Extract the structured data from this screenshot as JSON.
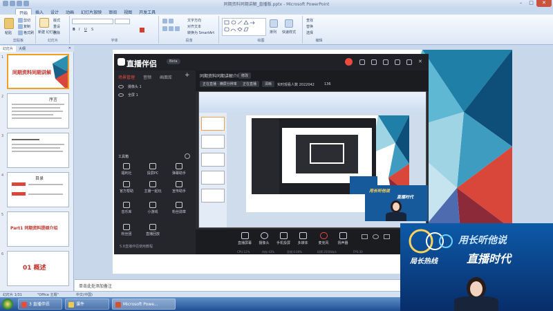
{
  "window": {
    "title": "同期资料同期讲解_直播版.pptx - Microsoft PowerPoint"
  },
  "ribbon": {
    "tabs": [
      "开始",
      "插入",
      "设计",
      "动画",
      "幻灯片放映",
      "审阅",
      "视图",
      "开发工具"
    ],
    "active_tab": "开始",
    "groups": [
      "剪贴板",
      "幻灯片",
      "字体",
      "段落",
      "绘图",
      "编辑"
    ],
    "paste_label": "粘贴",
    "new_slide_label": "新建\n幻灯片",
    "layout_label": "版式",
    "reset_label": "重设",
    "delete_label": "删除",
    "cut_label": "剪切",
    "copy_label": "复制",
    "format_painter_label": "格式刷",
    "text_direction_label": "文字方向",
    "align_text_label": "对齐文本",
    "smartart_label": "转换为 SmartArt",
    "arrange_label": "排列",
    "quick_styles_label": "快速样式",
    "find_label": "查找",
    "replace_label": "替换",
    "select_label": "选择"
  },
  "left_panel": {
    "tabs": [
      "幻灯片",
      "大纲"
    ],
    "slides": [
      {
        "num": "1",
        "title": "同期资料同期讲解"
      },
      {
        "num": "2",
        "title": "序言"
      },
      {
        "num": "3",
        "title": ""
      },
      {
        "num": "4",
        "title": "目录"
      },
      {
        "num": "5",
        "title": "Part1 同期资料提纲介绍"
      },
      {
        "num": "6",
        "title": "01 概述"
      },
      {
        "num": "7",
        "title": ""
      }
    ]
  },
  "live_app": {
    "logo": "直播伴侣",
    "beta": "Beta",
    "side_tabs": [
      "场景管理",
      "音频",
      "画面库"
    ],
    "scenes": [
      "摄像头 1",
      "全屏 1"
    ],
    "tools_title": "工具箱",
    "tools": [
      "福利社",
      "投屏PC",
      "弹幕助手",
      "官方帮助",
      "主播一起玩",
      "宣传助手",
      "音乐库",
      "小游戏",
      "粉丝勋章",
      "粉丝团",
      "直播回放"
    ],
    "footer": "5.8直播伴侣使用教程",
    "top": {
      "room_title": "同期资料同期讲解介绍",
      "edit": "修改",
      "chip1": "正在直播 · 横屏分辨率",
      "chip2": "正在直播",
      "chip3": "清晰",
      "stats": "实时观看人数 2022042",
      "likes": "136"
    },
    "bottom_buttons": [
      "直播屏幕",
      "摄像头",
      "手机投屏",
      "多媒体",
      "麦克风",
      "扬声器"
    ],
    "status_items": [
      "CPU:12%",
      "内存:43%",
      "丢帧:0.00%",
      "码率:2500kb/s",
      "FPS:30"
    ]
  },
  "webcam": {
    "banner_top": "用长听他说",
    "banner_logo": "直播时代",
    "banner_sub": "局长热线"
  },
  "notes": {
    "placeholder": "单击此处添加备注"
  },
  "statusbar": {
    "slide_info": "幻灯片 1/31",
    "theme": "\"Office 主题\"",
    "language": "中文(中国)"
  },
  "taskbar": {
    "items": [
      "3 直播伴侣",
      "课件",
      "Microsoft Powe..."
    ]
  },
  "colors": {
    "accent_red": "#e94b3c",
    "live_bg": "#1b1c20",
    "ribbon_blue": "#c9daf0",
    "slide_selected": "#f0a020"
  }
}
